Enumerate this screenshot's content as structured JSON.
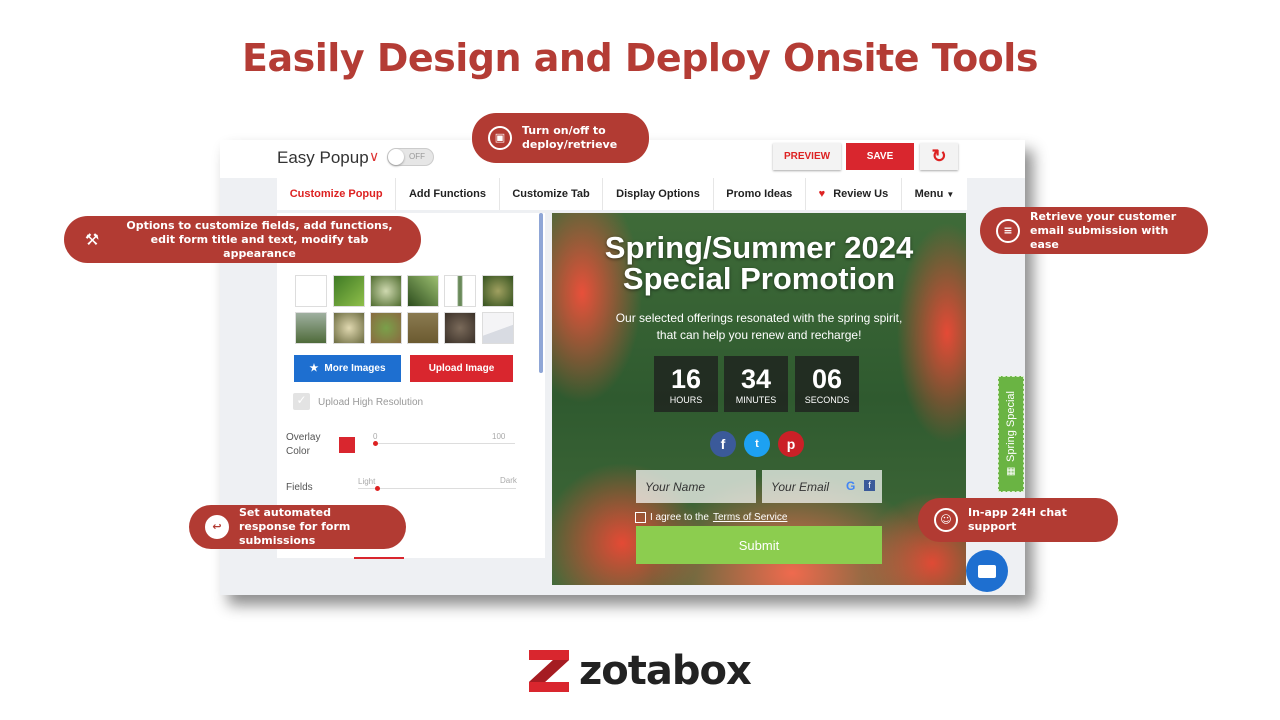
{
  "headline": "Easily Design and Deploy Onsite Tools",
  "app": {
    "name": "Easy Popup",
    "toggle": "OFF",
    "preview": "PREVIEW",
    "save": "SAVE"
  },
  "nav": [
    "Customize Popup",
    "Add Functions",
    "Customize Tab",
    "Display Options",
    "Promo Ideas",
    "Review Us",
    "Menu"
  ],
  "left_panel": {
    "more_images": "More Images",
    "upload_image": "Upload Image",
    "high_res": "Upload High Resolution",
    "overlay_label": "Overlay Color",
    "overlay_color": "#d9262e",
    "overlay_min": "0",
    "overlay_max": "100",
    "overlay_value": 0,
    "fields_label": "Fields",
    "fields_min": "Light",
    "fields_max": "Dark",
    "fields_value": 5
  },
  "popup": {
    "title": "Spring/Summer 2024 Special Promotion",
    "subtitle_1": "Our selected offerings resonated with the spring spirit,",
    "subtitle_2": "that can help you renew and recharge!",
    "countdown": [
      {
        "n": "16",
        "u": "HOURS"
      },
      {
        "n": "34",
        "u": "MINUTES"
      },
      {
        "n": "06",
        "u": "SECONDS"
      }
    ],
    "name_placeholder": "Your Name",
    "email_placeholder": "Your Email",
    "agree": "I agree to the",
    "tos": "Terms of Service",
    "submit": "Submit"
  },
  "side_tab": "Spring Special",
  "callouts": {
    "toggle": "Turn on/off to deploy/retrieve",
    "options": "Options to customize fields, add functions, edit form title and text, modify tab appearance",
    "email": "Retrieve your customer email submission with ease",
    "auto": "Set automated response for form submissions",
    "chat": "In-app 24H chat support"
  },
  "logo": "zotabox",
  "colors": {
    "brand": "#b23b33",
    "save": "#d9262e",
    "submit": "#8ccd4f",
    "more": "#1e6fd0"
  }
}
